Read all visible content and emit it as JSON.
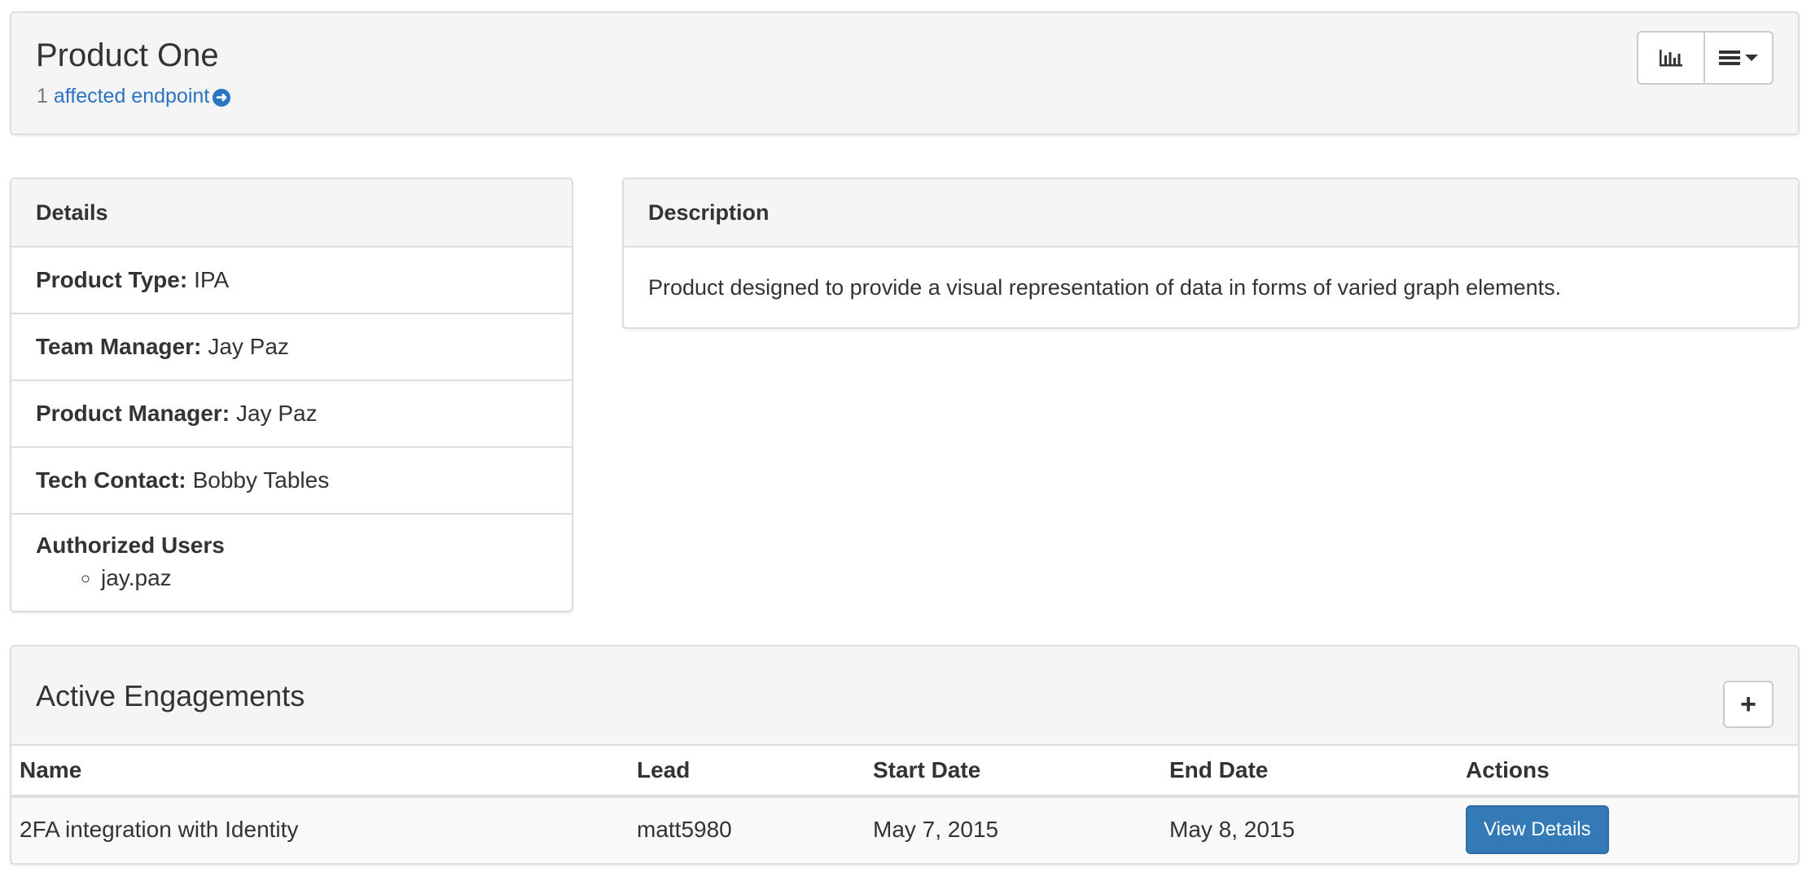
{
  "header": {
    "title": "Product One",
    "endpoint_count": "1",
    "endpoint_link": "affected endpoint",
    "metrics_icon": "bar-chart-icon",
    "menu_icon": "hamburger-menu-icon"
  },
  "details": {
    "heading": "Details",
    "rows": [
      {
        "label": "Product Type:",
        "value": "IPA"
      },
      {
        "label": "Team Manager:",
        "value": "Jay Paz"
      },
      {
        "label": "Product Manager:",
        "value": "Jay Paz"
      },
      {
        "label": "Tech Contact:",
        "value": "Bobby Tables"
      }
    ],
    "authorized_label": "Authorized Users",
    "authorized_users": [
      "jay.paz"
    ]
  },
  "description": {
    "heading": "Description",
    "text": "Product designed to provide a visual representation of data in forms of varied graph elements."
  },
  "engagements": {
    "title": "Active Engagements",
    "add_label": "+",
    "columns": [
      "Name",
      "Lead",
      "Start Date",
      "End Date",
      "Actions"
    ],
    "rows": [
      {
        "name": "2FA integration with Identity",
        "lead": "matt5980",
        "start": "May 7, 2015",
        "end": "May 8, 2015",
        "action": "View Details"
      }
    ]
  },
  "colors": {
    "link": "#2a74c2",
    "primary_button": "#337ab7",
    "panel_heading": "#f5f5f5"
  }
}
